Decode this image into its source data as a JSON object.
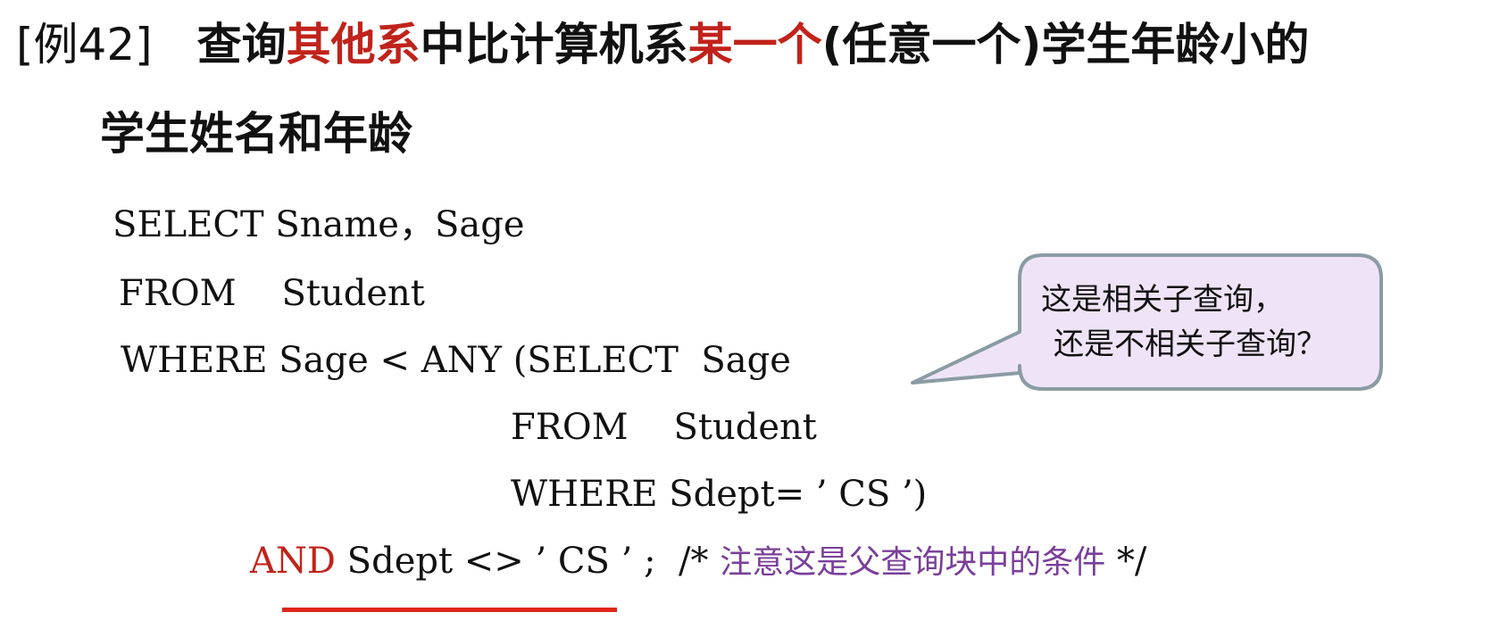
{
  "title": {
    "line1": {
      "tag": "[例42]",
      "part1": "查询",
      "part2_red": "其他系",
      "part3": "中比计算机系",
      "part4_red": "某一个",
      "part5": "(任意一个)学生年龄小的"
    },
    "line2": "学生姓名和年龄"
  },
  "code": {
    "line1": "SELECT Sname，Sage",
    "line2": "FROM    Student",
    "line3": "WHERE Sage < ANY (SELECT  Sage",
    "line4": "FROM    Student",
    "line5": "WHERE Sdept= ’ CS ’)",
    "line6_keyword": "AND",
    "line6_rest": " Sdept <> ’ CS ’ ;  /* ",
    "line6_comment": "注意这是父查询块中的条件",
    "line6_end": " */"
  },
  "callout": {
    "line1": "这是相关子查询，",
    "line2": "还是不相关子查询？"
  },
  "colors": {
    "highlight_red": "#c0231b",
    "comment_purple": "#7a3f9a",
    "callout_fill": "#efe4f7",
    "callout_border": "#8a9ba3",
    "underline_red": "#e0261a"
  }
}
